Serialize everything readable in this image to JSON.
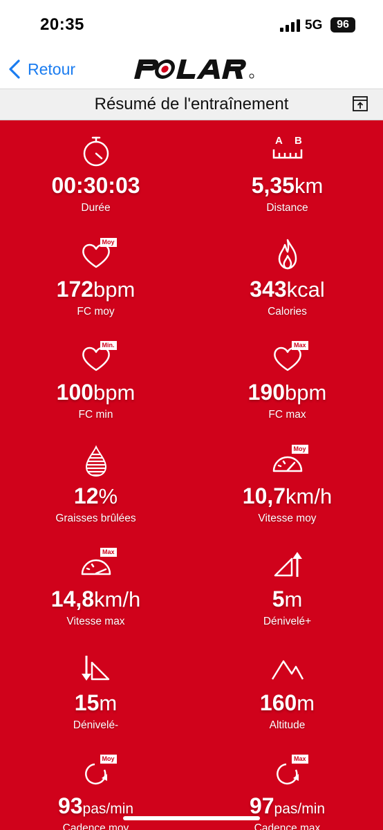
{
  "status_bar": {
    "time": "20:35",
    "network": "5G",
    "battery": "96"
  },
  "nav": {
    "back_label": "Retour",
    "logo_text": "POLAR"
  },
  "title": "Résumé de l'entraînement",
  "colors": {
    "accent": "#d0021b",
    "link": "#1a7cf0"
  },
  "stats": [
    {
      "icon": "stopwatch-icon",
      "value": "00:30:03",
      "unit": "",
      "label": "Durée"
    },
    {
      "icon": "distance-ab-icon",
      "value": "5,35",
      "unit": "km",
      "label": "Distance",
      "icon_text": [
        "A",
        "B"
      ]
    },
    {
      "icon": "heart-avg-icon",
      "badge": "Moy",
      "value": "172",
      "unit": "bpm",
      "label": "FC moy"
    },
    {
      "icon": "flame-icon",
      "value": "343",
      "unit": "kcal",
      "label": "Calories"
    },
    {
      "icon": "heart-min-icon",
      "badge": "Min.",
      "value": "100",
      "unit": "bpm",
      "label": "FC min"
    },
    {
      "icon": "heart-max-icon",
      "badge": "Max",
      "value": "190",
      "unit": "bpm",
      "label": "FC max"
    },
    {
      "icon": "fat-drop-icon",
      "value": "12",
      "unit": "%",
      "label": "Graisses brûlées"
    },
    {
      "icon": "speedometer-avg-icon",
      "badge": "Moy",
      "value": "10,7",
      "unit": "km/h",
      "label": "Vitesse moy"
    },
    {
      "icon": "speedometer-max-icon",
      "badge": "Max",
      "value": "14,8",
      "unit": "km/h",
      "label": "Vitesse max"
    },
    {
      "icon": "ascent-icon",
      "value": "5",
      "unit": "m",
      "label": "Dénivelé+"
    },
    {
      "icon": "descent-icon",
      "value": "15",
      "unit": "m",
      "label": "Dénivelé-"
    },
    {
      "icon": "mountain-icon",
      "value": "160",
      "unit": "m",
      "label": "Altitude"
    },
    {
      "icon": "cadence-avg-icon",
      "badge": "Moy",
      "value": "93",
      "unit": "pas/min",
      "label": "Cadence moy"
    },
    {
      "icon": "cadence-max-icon",
      "badge": "Max",
      "value": "97",
      "unit": "pas/min",
      "label": "Cadence max"
    }
  ]
}
